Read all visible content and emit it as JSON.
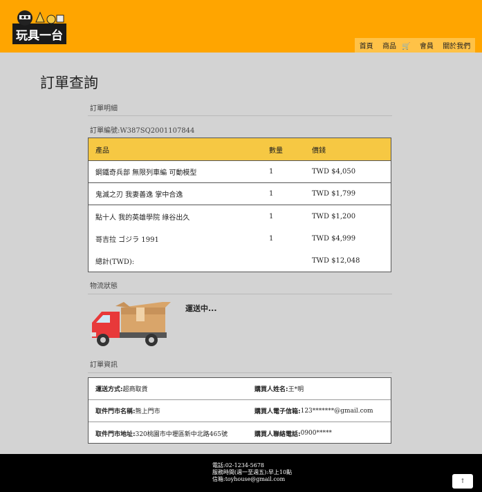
{
  "header": {
    "logo_text": "玩具一台",
    "nav": [
      "首頁",
      "商品",
      "會員",
      "關於我們"
    ],
    "cart_icon": "cart-icon",
    "colors": {
      "header_bg": "#ffa500",
      "nav_bg": "#ffc247",
      "table_head": "#f6c843"
    }
  },
  "page": {
    "title": "訂單查詢"
  },
  "order": {
    "detail_heading": "訂單明細",
    "number_label": "訂單編號:W387SQ2001107844",
    "columns": [
      "產品",
      "數量",
      "價錢"
    ],
    "items": [
      {
        "name": "鋼鐵奇兵部 無限列車編 可動模型",
        "qty": "1",
        "price": "TWD  $4,050"
      },
      {
        "name": "鬼滅之刃 我妻善逸 掌中合逸",
        "qty": "1",
        "price": "TWD  $1,799"
      },
      {
        "name": "點十人 我的英雄學院 綠谷出久",
        "qty": "1",
        "price": "TWD  $1,200"
      },
      {
        "name": "哥吉拉 ゴジラ 1991",
        "qty": "1",
        "price": "TWD  $4,999"
      }
    ],
    "total_label": "總計(TWD):",
    "total_value": "TWD  $12,048"
  },
  "shipping": {
    "heading": "物流狀態",
    "status": "運送中...",
    "truck_icon": "delivery-truck-icon"
  },
  "info": {
    "heading": "訂單資訊",
    "rows": [
      {
        "l_label": "運送方式:",
        "l_value": " 超商取貨",
        "r_label": "購買人姓名:",
        "r_value": " 王*明"
      },
      {
        "l_label": "取件門市名稱:",
        "l_value": " 熊上門市",
        "r_label": "購買人電子信箱:",
        "r_value": " 123*******@gmail.com"
      },
      {
        "l_label": "取件門市地址:",
        "l_value": " 320桃園市中壢區新中北路465號",
        "r_label": "購買人聯絡電話:",
        "r_value": " 0900*****"
      }
    ]
  },
  "footer": {
    "lines": [
      "電話:02-1234-5678",
      "服務時間(週一至週五):早上10點",
      "信箱:toyhouse@gmail.com"
    ],
    "to_top": "↑"
  }
}
